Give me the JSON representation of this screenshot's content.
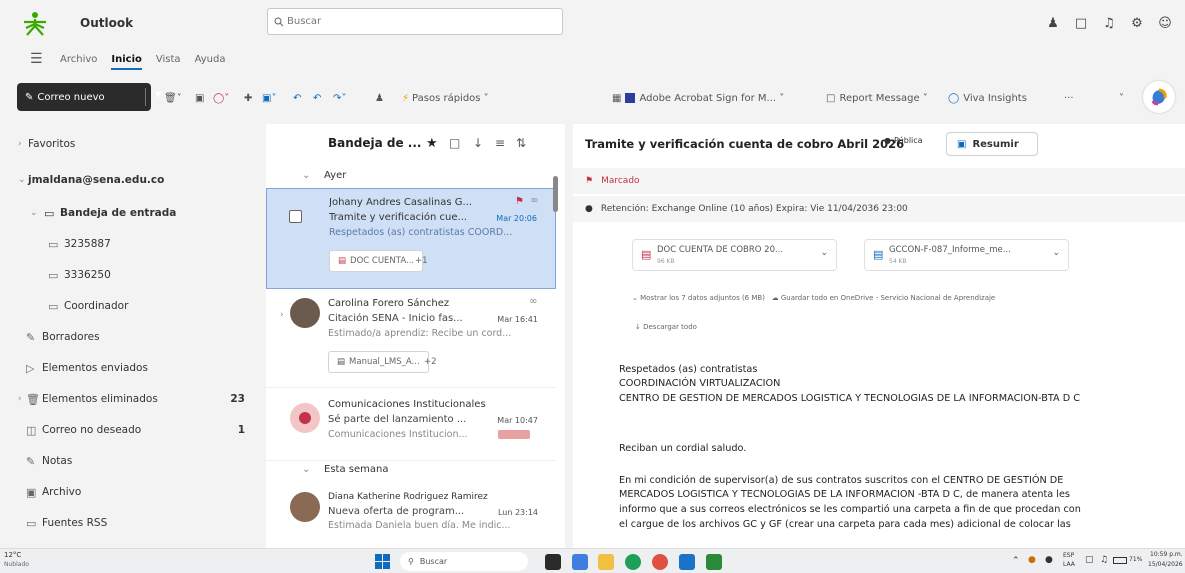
{
  "app": {
    "name": "Outlook",
    "search_placeholder": "Buscar"
  },
  "menu": {
    "items": [
      "Archivo",
      "Inicio",
      "Vista",
      "Ayuda"
    ],
    "active": "Inicio"
  },
  "ribbon": {
    "new_mail": "Correo nuevo",
    "quick_steps": "Pasos rápidos",
    "acrobat": "Adobe Acrobat Sign for M...",
    "report": "Report Message",
    "viva": "Viva Insights"
  },
  "sidebar": {
    "favorites": "Favoritos",
    "account": "jmaldana@sena.edu.co",
    "inbox": "Bandeja de entrada",
    "folders": [
      {
        "label": "3235887",
        "count": ""
      },
      {
        "label": "3336250",
        "count": ""
      },
      {
        "label": "Coordinador",
        "count": ""
      },
      {
        "label": "Borradores",
        "count": ""
      },
      {
        "label": "Elementos enviados",
        "count": ""
      },
      {
        "label": "Elementos eliminados",
        "count": "23"
      },
      {
        "label": "Correo no deseado",
        "count": "1"
      },
      {
        "label": "Notas",
        "count": ""
      },
      {
        "label": "Archivo",
        "count": ""
      },
      {
        "label": "Fuentes RSS",
        "count": ""
      }
    ]
  },
  "maillist": {
    "title": "Bandeja de ...",
    "group_yesterday": "Ayer",
    "group_week": "Esta semana",
    "mails": [
      {
        "from": "Johany Andres Casalinas G...",
        "subject": "Tramite y verificación cue...",
        "time": "Mar 20:06",
        "preview": "Respetados (as) contratistas COORD...",
        "attachment": "DOC CUENTA...",
        "extra": "+1"
      },
      {
        "from": "Carolina Forero Sánchez",
        "subject": "Citación SENA - Inicio fas...",
        "time": "Mar 16:41",
        "preview": "Estimado/a aprendiz: Recibe un cord...",
        "attachment": "Manual_LMS_A...",
        "extra": "+2"
      },
      {
        "from": "Comunicaciones Institucionales",
        "subject": "Sé parte del lanzamiento ...",
        "time": "Mar 10:47",
        "preview": "Comunicaciones Institucion...",
        "attachment": "",
        "extra": ""
      },
      {
        "from": "Diana Katherine Rodriguez Ramirez",
        "subject": "Nueva oferta de program...",
        "time": "Lun 23:14",
        "preview": "Estimada Daniela buen día. Me indic...",
        "attachment": "",
        "extra": ""
      }
    ]
  },
  "reading": {
    "subject": "Tramite y verificación cuenta de cobro Abril 2026",
    "badge": "Pública",
    "summarize": "Resumir",
    "flag_text": "Marcado",
    "retention": "Retención: Exchange Online (10 años) Expira: Vie 11/04/2036 23:00",
    "attachments": [
      {
        "name": "DOC CUENTA DE COBRO 20...",
        "size": "96 KB"
      },
      {
        "name": "GCCON-F-087_Informe_me...",
        "size": "54 KB"
      }
    ],
    "show_all": "Mostrar los 7 datos adjuntos (6 MB)",
    "save_onedrive": "Guardar todo en OneDrive - Servicio Nacional de Aprendizaje",
    "download_all": "Descargar todo",
    "body": [
      "Respetados (as) contratistas",
      "COORDINACIÓN VIRTUALIZACION",
      "CENTRO DE GESTION DE MERCADOS LOGISTICA Y TECNOLOGIAS DE LA INFORMACION-BTA D C",
      "Reciban un cordial saludo.",
      "En mi condición de supervisor(a) de sus contratos suscritos con el CENTRO DE GESTIÓN DE",
      "MERCADOS LOGISTICA Y TECNOLOGIAS DE LA INFORMACION -BTA D C, de manera atenta les",
      "informo que a sus correos electrónicos se les compartió una carpeta a fin de que procedan con",
      "el cargue de los archivos GC y GF (crear una carpeta para cada mes) adicional de colocar las"
    ]
  },
  "taskbar": {
    "weather": "12°C",
    "weather_desc": "Nublado",
    "search": "Buscar",
    "lang": "ESP",
    "lang2": "LAA",
    "battery": "71%",
    "time": "10:59 p.m.",
    "date": "15/04/2026"
  },
  "colors": {
    "accent": "#0f6cbd",
    "selected": "#cfe0f6",
    "flag": "#c4314b"
  }
}
